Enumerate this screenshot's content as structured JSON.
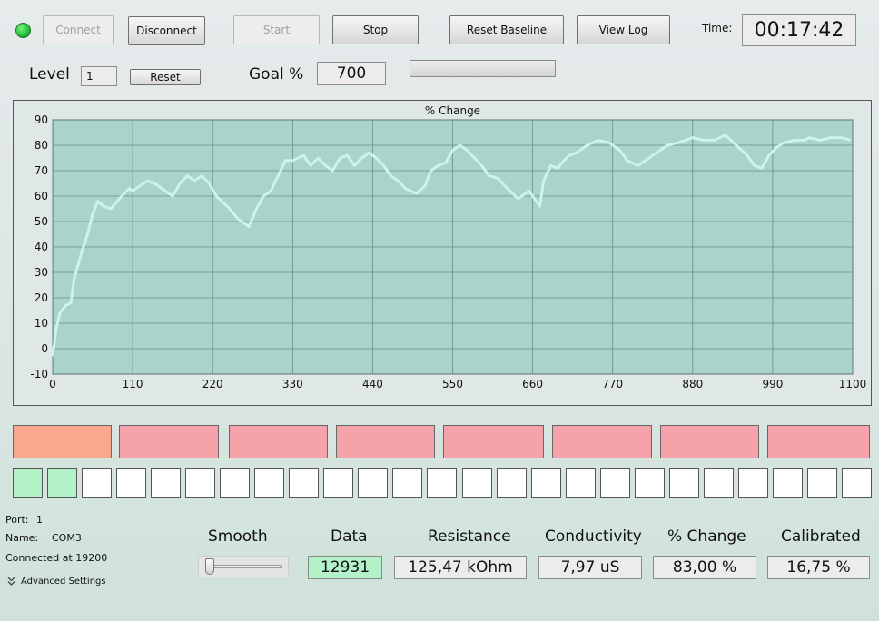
{
  "toolbar": {
    "connect": "Connect",
    "disconnect": "Disconnect",
    "start": "Start",
    "stop": "Stop",
    "reset_baseline": "Reset Baseline",
    "view_log": "View Log",
    "time_label": "Time:",
    "time_value": "00:17:42",
    "status_color": "#19c43a"
  },
  "row2": {
    "level_label": "Level",
    "level_value": "1",
    "reset": "Reset",
    "goal_label": "Goal %",
    "goal_value": "700",
    "goal_progress": 0
  },
  "chart_data": {
    "type": "line",
    "title": "% Change",
    "xlim": [
      0,
      1100
    ],
    "ylim": [
      -10,
      90
    ],
    "xticks": [
      0,
      110,
      220,
      330,
      440,
      550,
      660,
      770,
      880,
      990,
      1100
    ],
    "yticks": [
      90,
      80,
      70,
      60,
      50,
      40,
      30,
      20,
      10,
      0,
      -10
    ],
    "grid": true,
    "line_color": "#c9f5ee",
    "plot_bg": "#a9d3cb",
    "x": [
      0,
      5,
      10,
      18,
      25,
      30,
      40,
      48,
      55,
      62,
      70,
      80,
      95,
      105,
      110,
      120,
      130,
      140,
      155,
      165,
      175,
      185,
      195,
      205,
      215,
      225,
      240,
      255,
      270,
      280,
      290,
      300,
      310,
      320,
      330,
      345,
      355,
      365,
      375,
      385,
      395,
      405,
      415,
      425,
      435,
      445,
      455,
      465,
      475,
      485,
      500,
      512,
      520,
      530,
      540,
      550,
      560,
      570,
      580,
      590,
      600,
      612,
      625,
      640,
      655,
      670,
      675,
      685,
      695,
      700,
      710,
      720,
      735,
      750,
      765,
      780,
      790,
      805,
      820,
      835,
      845,
      860,
      870,
      880,
      895,
      910,
      925,
      940,
      955,
      965,
      975,
      985,
      995,
      1005,
      1020,
      1035,
      1040,
      1055,
      1070,
      1085,
      1097
    ],
    "y": [
      -3,
      8,
      14,
      17,
      18,
      28,
      38,
      45,
      53,
      58,
      56,
      55,
      60,
      63,
      62,
      64,
      66,
      65,
      62,
      60,
      65,
      68,
      66,
      68,
      65,
      60,
      56,
      51,
      48,
      55,
      60,
      62,
      68,
      74,
      74,
      76,
      72,
      75,
      72,
      70,
      75,
      76,
      72,
      75,
      77,
      75,
      72,
      68,
      66,
      63,
      61,
      64,
      70,
      72,
      73,
      78,
      80,
      78,
      75,
      72,
      68,
      67,
      63,
      59,
      62,
      56,
      66,
      72,
      71,
      73,
      76,
      77,
      80,
      82,
      81,
      78,
      74,
      72,
      75,
      78,
      80,
      81,
      82,
      83,
      82,
      82,
      84,
      80,
      76,
      72,
      71,
      76,
      79,
      81,
      82,
      82,
      83,
      82,
      83,
      83,
      82
    ]
  },
  "progress_blocks": [
    {
      "color": "#f9a88c"
    },
    {
      "color": "#f5a2aa"
    },
    {
      "color": "#f5a2aa"
    },
    {
      "color": "#f5a2aa"
    },
    {
      "color": "#f5a2aa"
    },
    {
      "color": "#f5a2aa"
    },
    {
      "color": "#f5a2aa"
    },
    {
      "color": "#f5a2aa"
    }
  ],
  "level_squares": {
    "count": 25,
    "filled": 2,
    "fill_color": "#b3f1c9",
    "empty_color": "#ffffff"
  },
  "port_info": {
    "port_label": "Port:",
    "port_value": "1",
    "name_label": "Name:",
    "name_value": "COM3",
    "connected": "Connected at 19200",
    "advanced": "Advanced Settings"
  },
  "smooth": {
    "label": "Smooth",
    "value": 0
  },
  "readouts": {
    "data_label": "Data",
    "data_value": "12931",
    "data_bg": "#b3f1c9",
    "resistance_label": "Resistance",
    "resistance_value": "125,47 kOhm",
    "conductivity_label": "Conductivity",
    "conductivity_value": "7,97 uS",
    "change_label": "% Change",
    "change_value": "83,00 %",
    "calibrated_label": "Calibrated",
    "calibrated_value": "16,75 %"
  }
}
